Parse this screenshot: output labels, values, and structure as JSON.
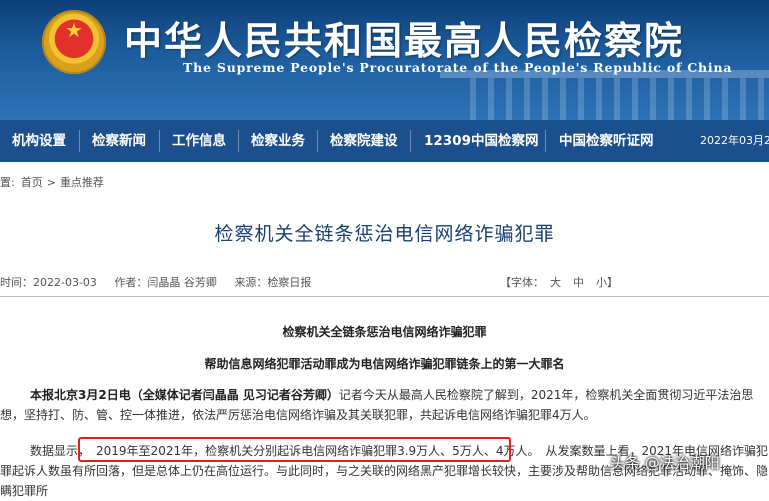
{
  "header": {
    "title": "中华人民共和国最高人民检察院",
    "subtitle": "The Supreme People's Procuratorate of the People's Republic of China"
  },
  "nav": {
    "items": [
      "机构设置",
      "检察新闻",
      "工作信息",
      "检察业务",
      "检察院建设",
      "12309中国检察网",
      "中国检察听证网"
    ],
    "date": "2022年03月2"
  },
  "breadcrumb": {
    "prefix": "置:",
    "home": "首页",
    "section": "重点推荐"
  },
  "article": {
    "headline": "检察机关全链条惩治电信网络诈骗犯罪",
    "time": "时间：2022-03-03",
    "author": "作者：闫晶晶  谷芳卿",
    "source": "来源：检察日报",
    "font_label": "【字体：",
    "font_large": "大",
    "font_medium": "中",
    "font_small": "小】",
    "title_main": "检察机关全链条惩治电信网络诈骗犯罪",
    "title_sub": "帮助信息网络犯罪活动罪成为电信网络诈骗犯罪链条上的第一大罪名",
    "para1_bold": "本报北京3月2日电（全媒体记者闫晶晶  见习记者谷芳卿）",
    "para1_text": "记者今天从最高人民检察院了解到，2021年，检察机关全面贯彻习近平法治思想，坚持打、防、管、控一体推进，依法严厉惩治电信网络诈骗及其关联犯罪，共起诉电信网络诈骗犯罪4万人。",
    "para2_lead": "数据显示，",
    "para2_highlight": "2019年至2021年，检察机关分别起诉电信网络诈骗犯罪3.9万人、5万人、4万人。",
    "para2_rest": "从发案数量上看，2021年电信网络诈骗犯罪起诉人数虽有所回落，但是总体上仍在高位运行。与此同时，与之关联的网络黑产犯罪增长较快，主要涉及帮助信息网络犯罪活动罪、掩饰、隐瞒犯罪所"
  },
  "watermark": "头条 @法治潮阳"
}
